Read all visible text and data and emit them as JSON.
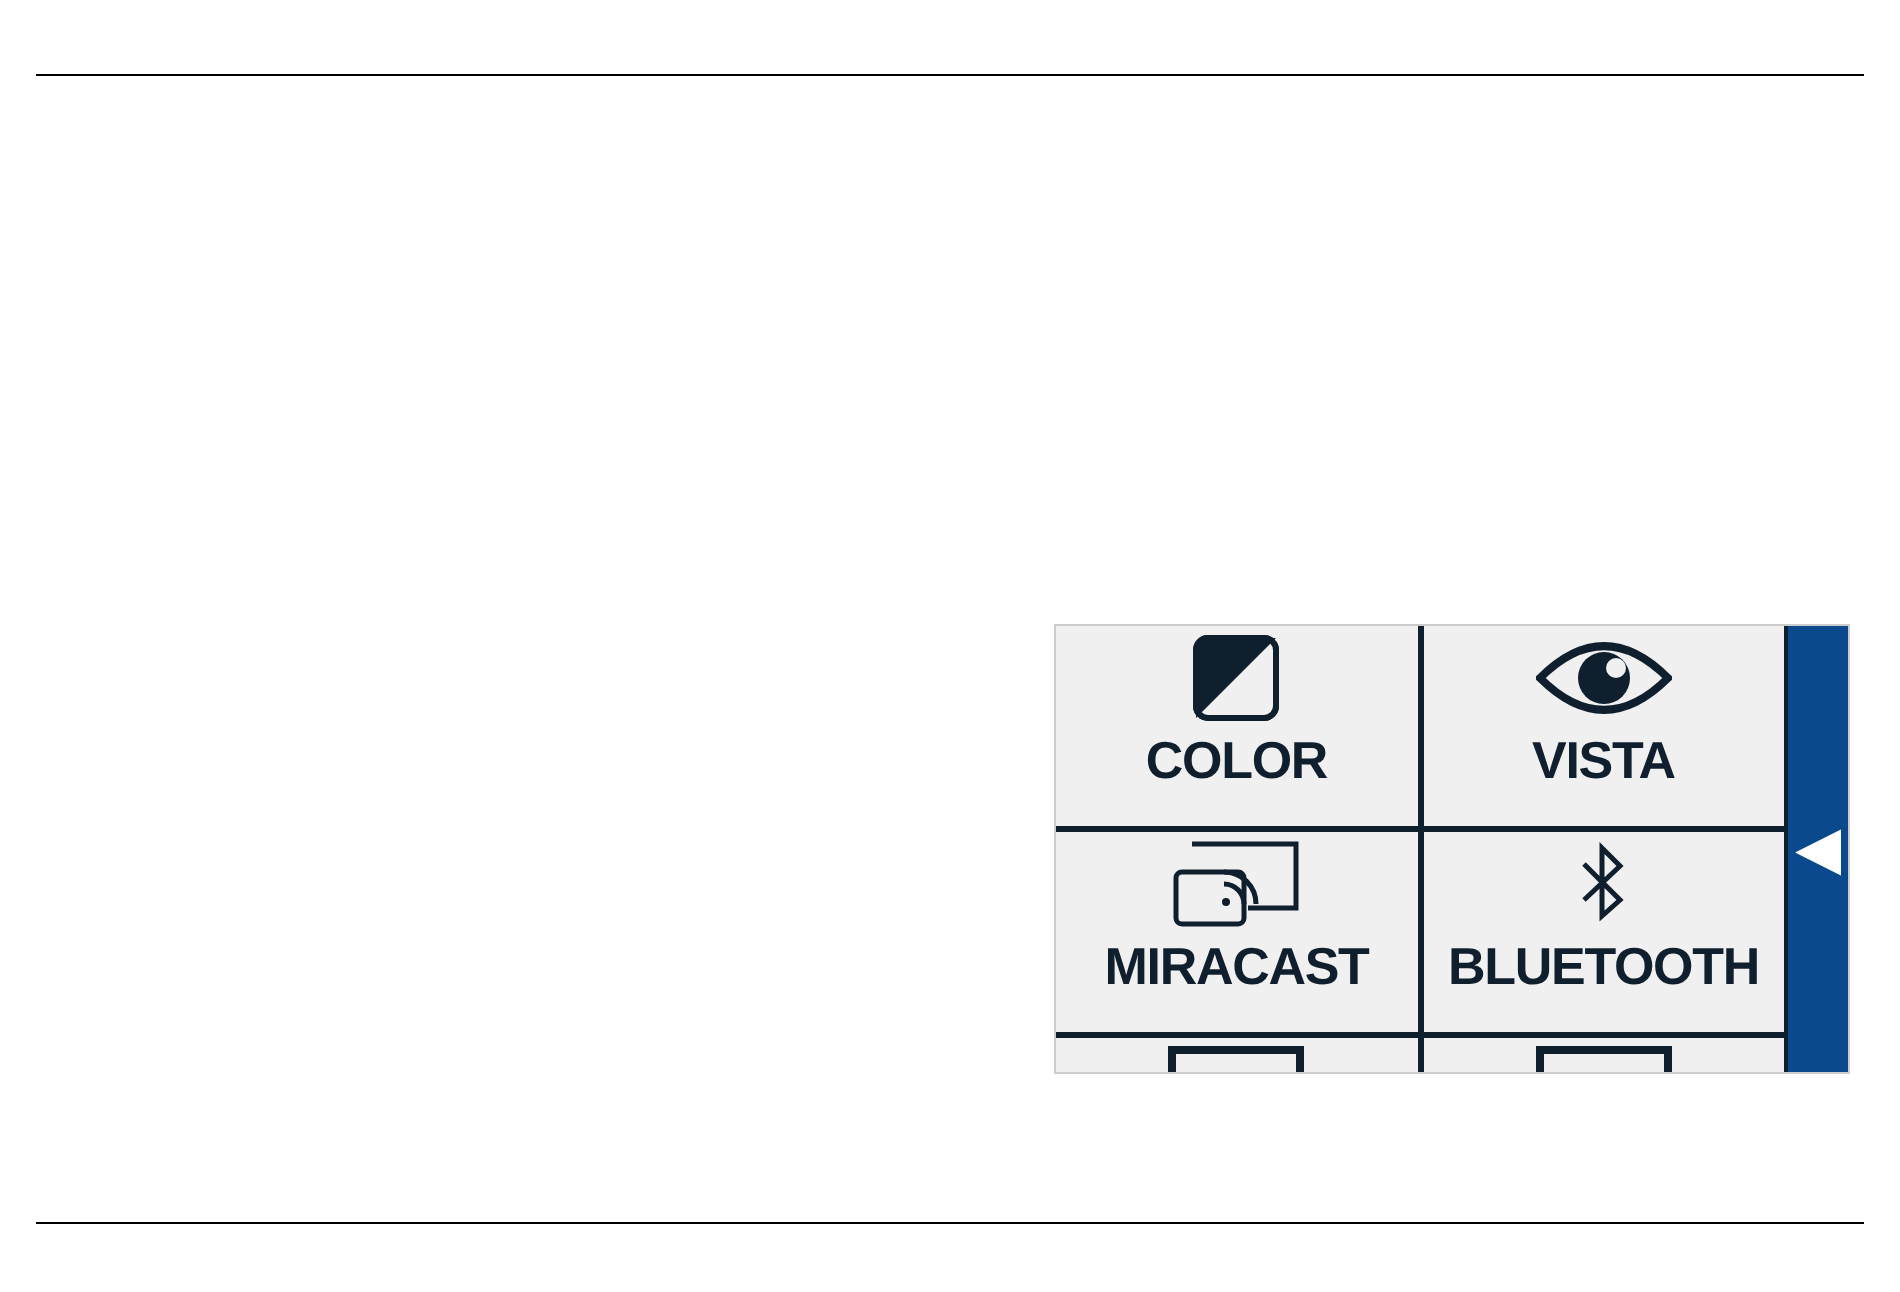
{
  "menu": {
    "tiles": [
      {
        "kind": "color",
        "label": "COLOR"
      },
      {
        "kind": "eye",
        "label": "VISTA"
      },
      {
        "kind": "cast",
        "label": "MIRACAST"
      },
      {
        "kind": "bluetooth",
        "label": "BLUETOOTH"
      },
      {
        "kind": "frame"
      },
      {
        "kind": "frame"
      }
    ],
    "side_button": {
      "glyph": "◀"
    }
  }
}
